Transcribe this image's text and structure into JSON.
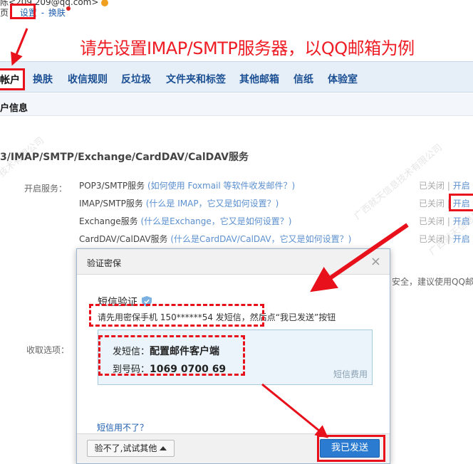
{
  "top": {
    "email": "陈<209      209@qq.com>",
    "home_suffix": "页",
    "settings_link": "设置",
    "separator": "-",
    "skin_link": "换肤"
  },
  "annotation": {
    "title": "请先设置IMAP/SMTP服务器，以QQ邮箱为例"
  },
  "tabs": [
    {
      "label": "帐户"
    },
    {
      "label": "换肤"
    },
    {
      "label": "收信规则"
    },
    {
      "label": "反垃圾"
    },
    {
      "label": "文件夹和标签"
    },
    {
      "label": "其他邮箱"
    },
    {
      "label": "信纸"
    },
    {
      "label": "体验室"
    }
  ],
  "section": {
    "title": "户信息",
    "services_title": "3/IMAP/SMTP/Exchange/CardDAV/CalDAV服务",
    "enable_label": "开启服务：",
    "receive_label": "收取选项：",
    "right_note": "安全，建议使用QQ邮"
  },
  "services": [
    {
      "name": "POP3/SMTP服务",
      "help": "(如何使用 Foxmail 等软件收发邮件？)",
      "status": "已关闭",
      "action": "开启"
    },
    {
      "name": "IMAP/SMTP服务",
      "help": "(什么是 IMAP，它又是如何设置？)",
      "status": "已关闭",
      "action": "开启"
    },
    {
      "name": "Exchange服务",
      "help": "(什么是Exchange，它又是如何设置？)",
      "status": "已关闭",
      "action": "开启"
    },
    {
      "name": "CardDAV/CalDAV服务",
      "help": "(什么是CardDAV/CalDAV，它又是如何设置？)",
      "status": "已关闭",
      "action": "开启"
    }
  ],
  "watermark": {
    "text1": "广西就天信息技术有限公司",
    "text2": "广西就天信息技术有限公司",
    "text3": "技术有限公司"
  },
  "dialog": {
    "title": "验证密保",
    "close": "×",
    "sms_title": "短信验证",
    "sms_desc": "请先用密保手机 150******54 发短信，然后点“我已发送”按钮",
    "send_label": "发短信：",
    "send_content": "配置邮件客户端",
    "to_label": "到号码：",
    "to_number": "1069 0700 69",
    "fee": "短信费用",
    "cant_use": "短信用不了？",
    "other_button": "验不了,试试其他",
    "sent_button": "我已发送"
  },
  "colors": {
    "annotation_red": "#e8101a",
    "primary_blue": "#2b7bd1",
    "tab_blue": "#1b4f93"
  }
}
